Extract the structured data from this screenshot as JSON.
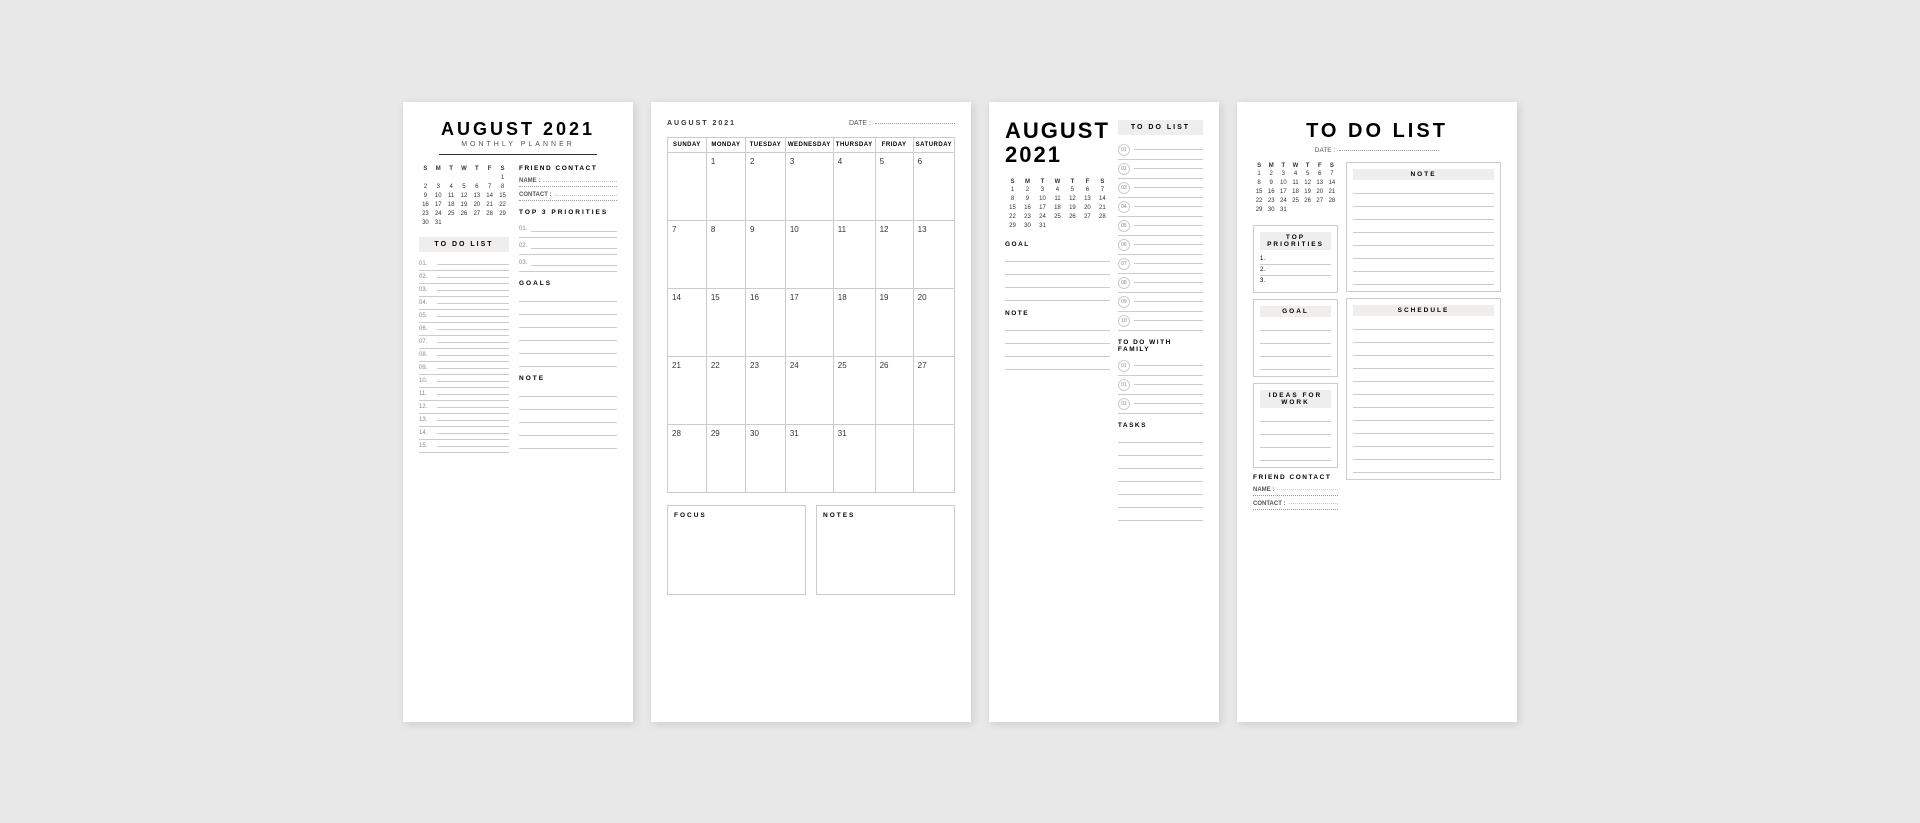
{
  "page1": {
    "title": "AUGUST 2021",
    "subtitle": "MONTHLY PLANNER",
    "calendar": {
      "days": [
        "S",
        "M",
        "T",
        "W",
        "T",
        "F",
        "S"
      ],
      "weeks": [
        [
          "",
          "",
          "",
          "",
          "",
          "",
          "1"
        ],
        [
          "2",
          "3",
          "4",
          "5",
          "6",
          "7",
          "8",
          "9",
          "10",
          "11",
          "12",
          "13",
          "14"
        ],
        [
          "8",
          "9",
          "10",
          "11",
          "12",
          "13",
          "14"
        ],
        [
          "15",
          "16",
          "17",
          "18",
          "19",
          "20",
          "21"
        ],
        [
          "22",
          "23",
          "24",
          "25",
          "26",
          "27",
          "28"
        ],
        [
          "29",
          "30",
          "31",
          "",
          "",
          "",
          ""
        ]
      ]
    },
    "todo_label": "TO DO LIST",
    "todo_items": [
      "01.",
      "02.",
      "03.",
      "04.",
      "05.",
      "06.",
      "07.",
      "08.",
      "09.",
      "10.",
      "11.",
      "12.",
      "13.",
      "14.",
      "15."
    ],
    "friend_contact": "FRIEND CONTACT",
    "name_label": "NAME :",
    "contact_label": "CONTACT :",
    "top3_label": "TOP 3 PRIORITIES",
    "priority_nums": [
      "01.",
      "02.",
      "03."
    ],
    "goals_label": "GOALS",
    "note_label": "NOTE"
  },
  "page2": {
    "month_label": "AUGUST 2021",
    "date_label": "DATE :",
    "days": [
      "SUNDAY",
      "MONDAY",
      "TUESDAY",
      "WEDNESDAY",
      "THURSDAY",
      "FRIDAY",
      "SATURDAY"
    ],
    "weeks": [
      [
        "",
        "1",
        "2",
        "3",
        "4",
        "5",
        "6",
        "7"
      ],
      [
        "8",
        "9",
        "10",
        "11",
        "12",
        "13",
        "14"
      ],
      [
        "15",
        "16",
        "17",
        "18",
        "19",
        "20",
        "21"
      ],
      [
        "22",
        "23",
        "24",
        "25",
        "26",
        "27",
        "28"
      ],
      [
        "29",
        "30",
        "31",
        "31",
        "",
        "",
        ""
      ]
    ],
    "focus_label": "FOCUS",
    "notes_label": "NOTES"
  },
  "page3": {
    "title": "AUGUST",
    "year": "2021",
    "calendar": {
      "days": [
        "S",
        "M",
        "T",
        "W",
        "T",
        "F",
        "S"
      ],
      "weeks": [
        [
          "1",
          "2",
          "3",
          "4",
          "5",
          "6",
          "7"
        ],
        [
          "8",
          "9",
          "10",
          "11",
          "12",
          "13",
          "14"
        ],
        [
          "15",
          "16",
          "17",
          "18",
          "19",
          "20",
          "21"
        ],
        [
          "22",
          "23",
          "24",
          "25",
          "26",
          "27",
          "28"
        ],
        [
          "29",
          "30",
          "31",
          "",
          "",
          "",
          ""
        ]
      ]
    },
    "todo_label": "TO DO LIST",
    "todo_nums": [
      "01",
      "02",
      "03",
      "04",
      "05",
      "06",
      "07",
      "08",
      "09",
      "10"
    ],
    "goal_label": "GOAL",
    "note_label": "NOTE",
    "family_label": "TO DO WITH FAMILY",
    "family_nums": [
      "01",
      "01",
      "01"
    ],
    "tasks_label": "TASKS"
  },
  "page4": {
    "title": "TO DO LIST",
    "date_label": "DATE :",
    "calendar": {
      "days": [
        "S",
        "M",
        "T",
        "W",
        "T",
        "F",
        "S"
      ],
      "weeks": [
        [
          "1",
          "2",
          "3",
          "4",
          "5",
          "6",
          "7"
        ],
        [
          "8",
          "9",
          "10",
          "11",
          "12",
          "13",
          "14"
        ],
        [
          "15",
          "16",
          "17",
          "18",
          "19",
          "20",
          "21"
        ],
        [
          "22",
          "23",
          "24",
          "25",
          "26",
          "27",
          "28"
        ],
        [
          "29",
          "30",
          "31",
          "",
          "",
          "",
          ""
        ]
      ]
    },
    "note_label": "NOTE",
    "top_priorities_label": "TOP PRIORITIES",
    "priorities": [
      "1.",
      "2.",
      "3."
    ],
    "goal_label": "GOAL",
    "ideas_label": "IDEAS FOR WORK",
    "schedule_label": "SCHEDULE",
    "friend_label": "FRIEND CONTACT",
    "name_label": "NAME :",
    "contact_label": "CONTACT :"
  }
}
